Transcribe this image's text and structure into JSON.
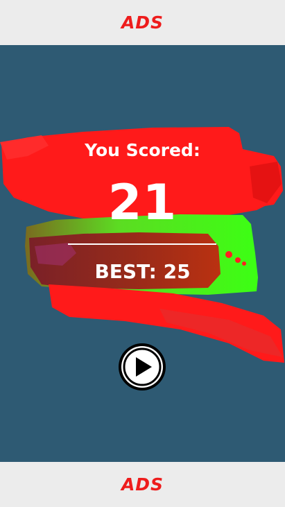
{
  "ads": {
    "top_label": "ADS",
    "bottom_label": "ADS"
  },
  "result": {
    "heading": "You Scored:",
    "score": "21",
    "best": "BEST: 25"
  },
  "controls": {
    "play_icon": "play-icon"
  },
  "colors": {
    "background": "#2e5a73",
    "paint_red": "#ff1a1a",
    "paint_green": "#3cff14",
    "ad_text": "#ee1c1c",
    "ad_bar": "#ececec"
  }
}
